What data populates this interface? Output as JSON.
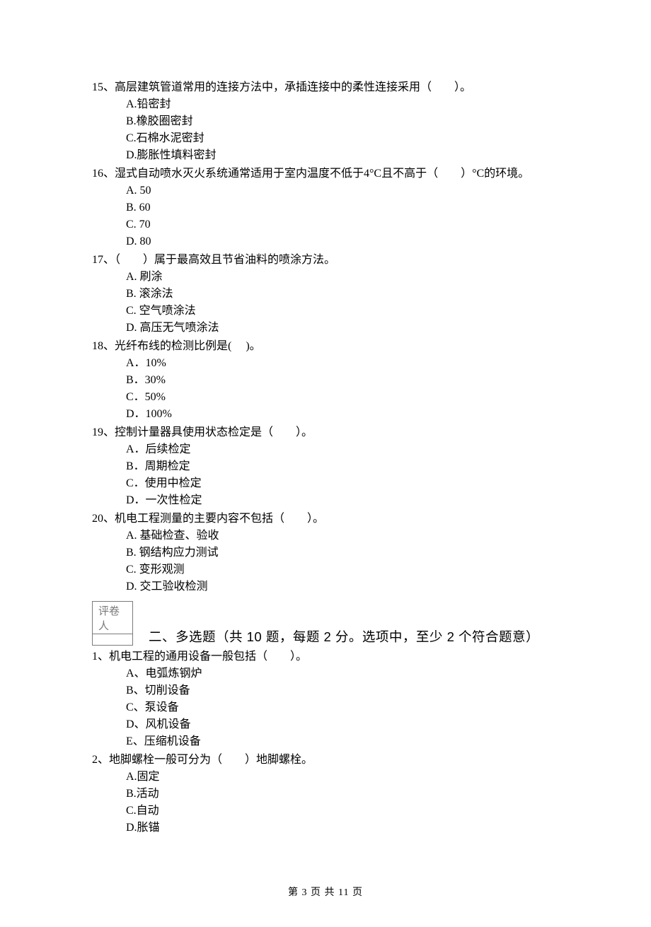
{
  "questions": [
    {
      "num": "15、",
      "text": "高层建筑管道常用的连接方法中，承插连接中的柔性连接采用（　　）。",
      "opts": [
        "A.铅密封",
        "B.橡胶圈密封",
        "C.石棉水泥密封",
        "D.膨胀性填料密封"
      ]
    },
    {
      "num": "16、",
      "text": "湿式自动喷水灭火系统通常适用于室内温度不低于4°C且不高于（　　）°C的环境。",
      "opts": [
        "A. 50",
        "B. 60",
        "C. 70",
        "D. 80"
      ]
    },
    {
      "num": "17、",
      "text": "（　　）属于最高效且节省油料的喷涂方法。",
      "opts": [
        "A. 刷涂",
        "B. 滚涂法",
        "C. 空气喷涂法",
        "D. 高压无气喷涂法"
      ]
    },
    {
      "num": "18、",
      "text": "光纤布线的检测比例是(　 )。",
      "opts": [
        "A．10%",
        "B．30%",
        "C．50%",
        "D．100%"
      ]
    },
    {
      "num": "19、",
      "text": "控制计量器具使用状态检定是（　　）。",
      "opts": [
        "A．后续检定",
        "B．周期检定",
        "C．使用中检定",
        "D．一次性检定"
      ]
    },
    {
      "num": "20、",
      "text": "机电工程测量的主要内容不包括（　　）。",
      "opts": [
        "A. 基础检查、验收",
        "B. 钢结构应力测试",
        "C. 变形观测",
        "D. 交工验收检测"
      ]
    }
  ],
  "grader_label": "评卷人",
  "section2_title": "二、多选题（共 10 题，每题 2 分。选项中，至少 2 个符合题意）",
  "mc_questions": [
    {
      "num": "1、",
      "text": "机电工程的通用设备一般包括（　　）。",
      "opts": [
        "A、电弧炼钢炉",
        "B、切削设备",
        "C、泵设备",
        "D、风机设备",
        "E、压缩机设备"
      ]
    },
    {
      "num": "2、",
      "text": "地脚螺栓一般可分为（　　）地脚螺栓。",
      "opts": [
        "A.固定",
        "B.活动",
        "C.自动",
        "D.胀锚"
      ]
    }
  ],
  "footer": "第 3 页 共 11 页"
}
